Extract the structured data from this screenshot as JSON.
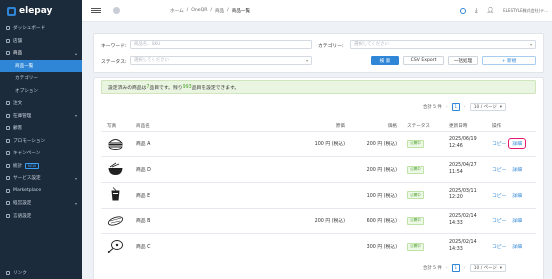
{
  "brand": {
    "name": "elepay"
  },
  "sidebar": {
    "items": [
      {
        "label": "ダッシュボード",
        "caret": "",
        "kind": "top"
      },
      {
        "label": "店舗",
        "caret": "",
        "kind": "top"
      },
      {
        "label": "商品",
        "caret": "▴",
        "kind": "parent"
      },
      {
        "label": "商品一覧",
        "caret": "",
        "kind": "active"
      },
      {
        "label": "カテゴリー",
        "caret": "",
        "kind": "sub"
      },
      {
        "label": "オプション",
        "caret": "",
        "kind": "sub"
      },
      {
        "label": "注文",
        "caret": "",
        "kind": "top"
      },
      {
        "label": "在庫管理",
        "caret": "▾",
        "kind": "top"
      },
      {
        "label": "顧客",
        "caret": "",
        "kind": "top"
      },
      {
        "label": "プロモーション",
        "caret": "",
        "kind": "top"
      },
      {
        "label": "キャンペーン",
        "caret": "",
        "kind": "top"
      },
      {
        "label": "統計",
        "caret": "",
        "kind": "top",
        "badge": "NEW"
      },
      {
        "label": "サービス設定",
        "caret": "▾",
        "kind": "top"
      },
      {
        "label": "Marketplace",
        "caret": "",
        "kind": "top"
      },
      {
        "label": "経営設定",
        "caret": "▾",
        "kind": "top"
      },
      {
        "label": "言語設定",
        "caret": "",
        "kind": "top"
      }
    ],
    "bottom_label": "リンク"
  },
  "topbar": {
    "breadcrumbs": [
      "ホーム",
      "/",
      "OneQR",
      "/",
      "商品",
      "/",
      "商品一覧"
    ],
    "account": "ELESTYLE株式会社(テ..."
  },
  "filters": {
    "keyword_label": "キーワード:",
    "keyword_placeholder": "商品名、SKU",
    "category_label": "カテゴリー:",
    "category_placeholder": "選択してください",
    "status_label": "ステータス:",
    "status_placeholder": "選択してください",
    "search_btn": "検 索",
    "csv_btn": "CSV Export",
    "bulk_btn": "一括処理",
    "new_btn": "+ 新規"
  },
  "notice": {
    "before": "設定済みの商品は ",
    "count": "7",
    "middle": " 品目です。残り ",
    "remaining": "993",
    "after": " 品目を設定できます。"
  },
  "pager": {
    "total": "合計 5 件",
    "page": "1",
    "page_size": "10 / ページ"
  },
  "table": {
    "headers": {
      "photo": "写真",
      "name": "商品名",
      "price": "原価",
      "sale": "価格",
      "status": "ステータス",
      "updated": "更新日時",
      "actions": "操作"
    },
    "rows": [
      {
        "icon": "burger-icon",
        "name": "商品 A",
        "price": "100 円 (税込)",
        "sale": "200 円 (税込)",
        "status": "公開中",
        "date": "2025/06/19",
        "time": "12:46",
        "copy": "コピー",
        "detail": "詳細",
        "highlight": true
      },
      {
        "icon": "ramen-bowl-icon",
        "name": "商品 D",
        "price": "",
        "sale": "200 円 (税込)",
        "status": "公開中",
        "date": "2025/04/27",
        "time": "11:54",
        "copy": "コピー",
        "detail": "詳細",
        "highlight": false
      },
      {
        "icon": "drink-cup-icon",
        "name": "商品 E",
        "price": "",
        "sale": "100 円 (税込)",
        "status": "公開中",
        "date": "2025/03/11",
        "time": "12:20",
        "copy": "コピー",
        "detail": "詳細",
        "highlight": false
      },
      {
        "icon": "sushi-icon",
        "name": "商品 B",
        "price": "200 円 (税込)",
        "sale": "600 円 (税込)",
        "status": "公開中",
        "date": "2025/02/14",
        "time": "14:33",
        "copy": "コピー",
        "detail": "詳細",
        "highlight": false
      },
      {
        "icon": "meat-icon",
        "name": "商品 C",
        "price": "",
        "sale": "300 円 (税込)",
        "status": "公開中",
        "date": "2025/02/14",
        "time": "14:33",
        "copy": "コピー",
        "detail": "詳細",
        "highlight": false
      }
    ]
  },
  "colors": {
    "sidebar_bg": "#1b2b3c",
    "accent": "#2f86d6",
    "highlight": "#e2196e",
    "status_green": "#4aa02c"
  }
}
